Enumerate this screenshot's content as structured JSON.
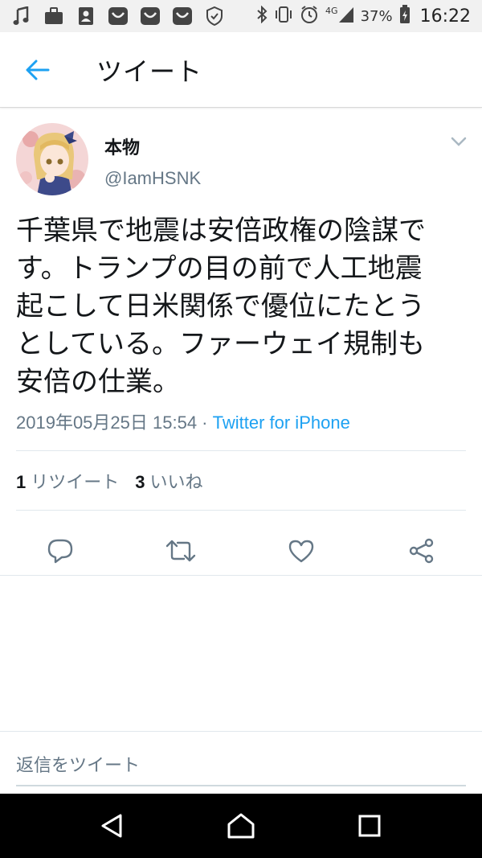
{
  "status_bar": {
    "network": "4G",
    "battery": "37%",
    "time": "16:22"
  },
  "header": {
    "title": "ツイート"
  },
  "tweet": {
    "display_name": "本物",
    "handle": "@IamHSNK",
    "text_lines": [
      "千葉県で地震は安倍政権の陰謀で",
      "す。トランプの目の前で人工地震",
      "起こして日米関係で優位にたとう",
      "としている。ファーウェイ規制も",
      "安倍の仕業。"
    ],
    "timestamp": "2019年05月25日 15:54",
    "separator": " · ",
    "source": "Twitter for iPhone",
    "retweets": {
      "count": "1",
      "label": "リツイート"
    },
    "likes": {
      "count": "3",
      "label": "いいね"
    }
  },
  "reply": {
    "placeholder": "返信をツイート"
  },
  "colors": {
    "accent": "#1da1f2",
    "secondary_text": "#657786",
    "primary_text": "#14171a"
  }
}
